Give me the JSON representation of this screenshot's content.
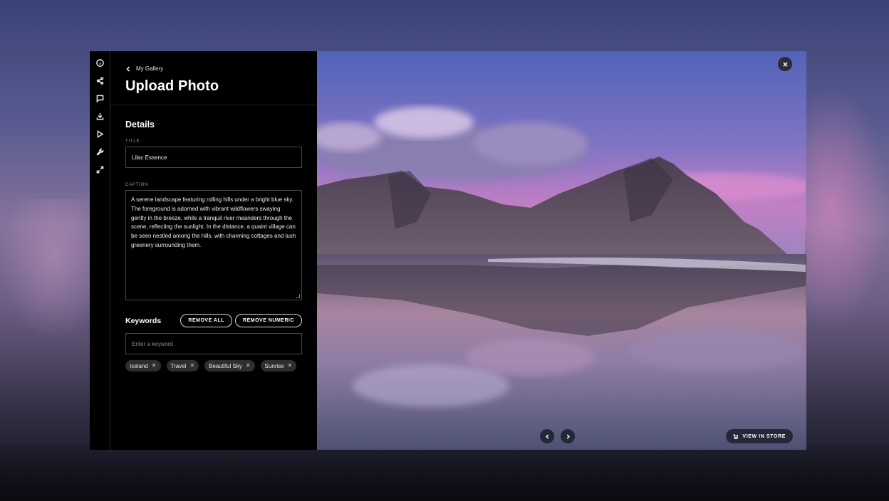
{
  "breadcrumb": {
    "label": "My Gallery"
  },
  "header": {
    "title": "Upload Photo"
  },
  "details": {
    "section_title": "Details",
    "title_label": "TITLE",
    "title_value": "Lilac Essence",
    "caption_label": "CAPTION",
    "caption_value": "A serene landscape featuring rolling hills under a bright blue sky. The foreground is adorned with vibrant wildflowers swaying gently in the breeze, while a tranquil river meanders through the scene, reflecting the sunlight. In the distance, a quaint village can be seen nestled among the hills, with charming cottages and lush greenery surrounding them."
  },
  "keywords": {
    "section_title": "Keywords",
    "remove_all_label": "REMOVE ALL",
    "remove_numeric_label": "REMOVE NUMERIC",
    "input_placeholder": "Enter a keyword",
    "tags": [
      "Iceland",
      "Travel",
      "Beautiful Sky",
      "Sunrise"
    ]
  },
  "rail_icons": [
    "info-icon",
    "share-icon",
    "comment-icon",
    "download-icon",
    "play-icon",
    "wrench-icon",
    "expand-icon"
  ],
  "viewer": {
    "store_label": "VIEW IN STORE"
  }
}
